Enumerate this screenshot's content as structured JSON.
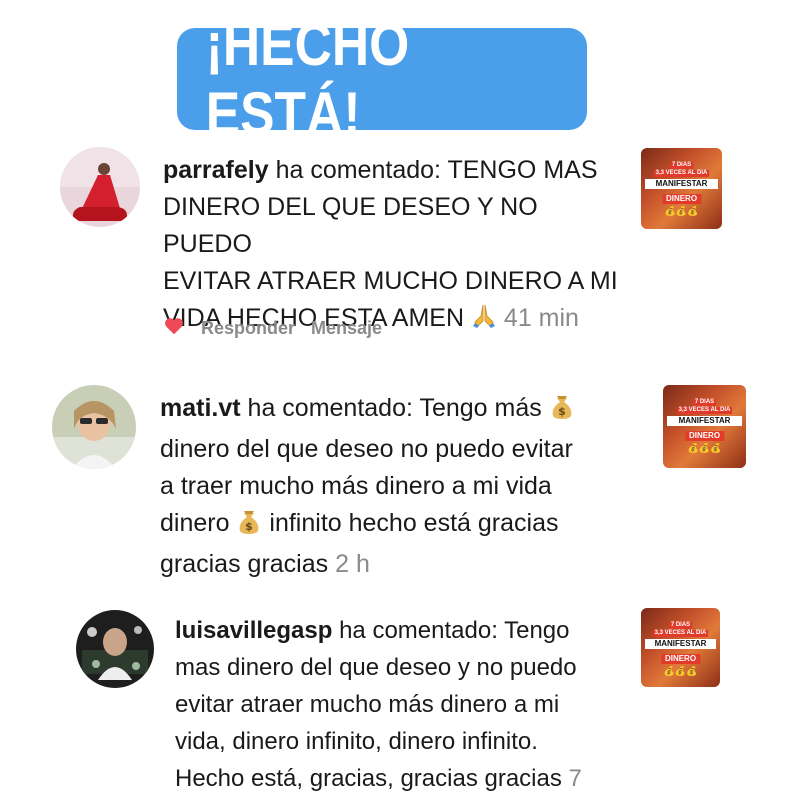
{
  "banner": {
    "text": "¡HECHO ESTÁ!"
  },
  "comments": [
    {
      "user": "parrafely",
      "action": "ha comentado:",
      "lines": [
        "TENGO MAS",
        "DINERO DEL QUE DESEO Y NO PUEDO",
        "EVITAR ATRAER MUCHO DINERO A MI",
        "VIDA HECHO ESTA AMEN"
      ],
      "time": "41 min",
      "reply_label": "Responder",
      "message_label": "Mensaje"
    },
    {
      "user": "mati.vt",
      "action": "ha comentado:",
      "lines": [
        "Tengo más",
        "dinero del que deseo no puedo evitar",
        "a traer mucho más dinero a mi vida",
        "dinero",
        "infinito hecho está gracias",
        "gracias gracias"
      ],
      "time": "2 h"
    },
    {
      "user": "luisavillegasp",
      "action": "ha comentado:",
      "lines": [
        "Tengo",
        "mas dinero del que deseo y no puedo",
        "evitar atraer mucho más dinero a mi",
        "vida, dinero  infinito,  dinero  infinito.",
        "Hecho está,  gracias,  gracias  gracias"
      ],
      "time": "7"
    }
  ],
  "thumbnail": {
    "top_badge": "7 DIAS",
    "sub_badge": "3,3 VECES AL DIA",
    "title": "MANIFESTAR",
    "subtitle": "DINERO",
    "coins": "💰💰💰"
  },
  "colors": {
    "banner": "#4a9eea",
    "heart": "#ed4956",
    "muted": "#8a8a8a"
  }
}
